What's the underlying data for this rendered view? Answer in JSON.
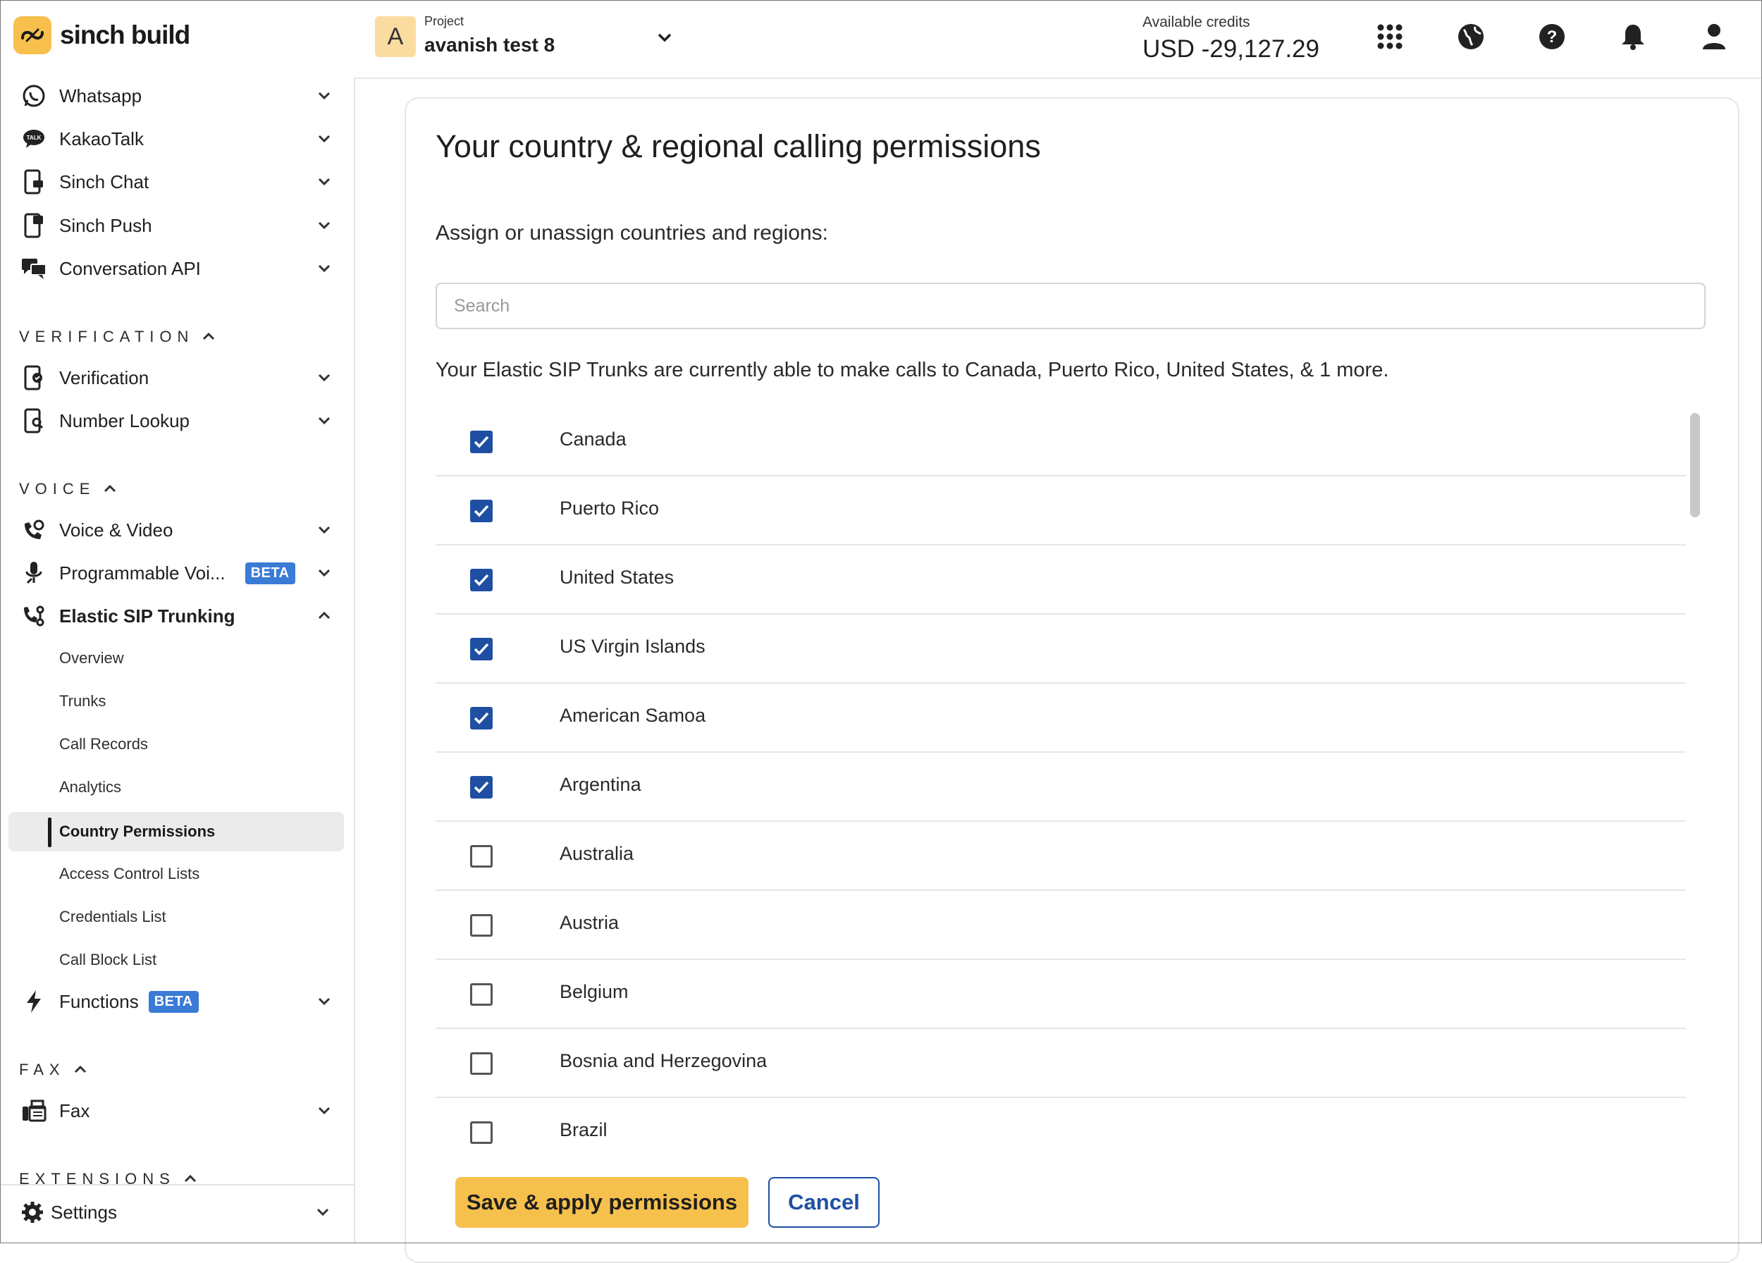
{
  "brand": {
    "name": "sinch build",
    "accent": "#f6c04c"
  },
  "sidebar": {
    "items": [
      {
        "label": "Whatsapp",
        "icon": "whatsapp-icon"
      },
      {
        "label": "KakaoTalk",
        "icon": "kakaotalk-icon"
      },
      {
        "label": "Sinch Chat",
        "icon": "chat-icon"
      },
      {
        "label": "Sinch Push",
        "icon": "push-icon"
      },
      {
        "label": "Conversation API",
        "icon": "conversation-icon"
      }
    ],
    "sections": {
      "verification": "VERIFICATION",
      "voice": "VOICE",
      "fax": "FAX",
      "extensions": "EXTENSIONS"
    },
    "verification_items": [
      {
        "label": "Verification",
        "icon": "verification-icon"
      },
      {
        "label": "Number Lookup",
        "icon": "number-lookup-icon"
      }
    ],
    "voice_items": [
      {
        "label": "Voice & Video",
        "icon": "voice-icon"
      },
      {
        "label": "Programmable Voi...",
        "icon": "programmable-voice-icon",
        "badge": "BETA"
      },
      {
        "label": "Elastic SIP Trunking",
        "icon": "sip-icon"
      }
    ],
    "sip_subitems": [
      "Overview",
      "Trunks",
      "Call Records",
      "Analytics",
      "Country Permissions",
      "Access Control Lists",
      "Credentials List",
      "Call Block List"
    ],
    "functions": {
      "label": "Functions",
      "badge": "BETA"
    },
    "fax": {
      "label": "Fax"
    },
    "settings": {
      "label": "Settings"
    }
  },
  "topbar": {
    "project_label": "Project",
    "project_name": "avanish test 8",
    "project_initial": "A",
    "credits_label": "Available credits",
    "credits_value": "USD -29,127.29"
  },
  "main": {
    "title": "Your country & regional calling permissions",
    "assign_label": "Assign or unassign countries and regions:",
    "search_placeholder": "Search",
    "summary": "Your Elastic SIP Trunks are currently able to make calls to Canada, Puerto Rico, United States, & 1 more.",
    "countries": [
      {
        "name": "Canada",
        "checked": true
      },
      {
        "name": "Puerto Rico",
        "checked": true
      },
      {
        "name": "United States",
        "checked": true
      },
      {
        "name": "US Virgin Islands",
        "checked": true
      },
      {
        "name": "American Samoa",
        "checked": true
      },
      {
        "name": "Argentina",
        "checked": true
      },
      {
        "name": "Australia",
        "checked": false
      },
      {
        "name": "Austria",
        "checked": false
      },
      {
        "name": "Belgium",
        "checked": false
      },
      {
        "name": "Bosnia and Herzegovina",
        "checked": false
      },
      {
        "name": "Brazil",
        "checked": false
      }
    ],
    "save_label": "Save & apply permissions",
    "cancel_label": "Cancel"
  }
}
